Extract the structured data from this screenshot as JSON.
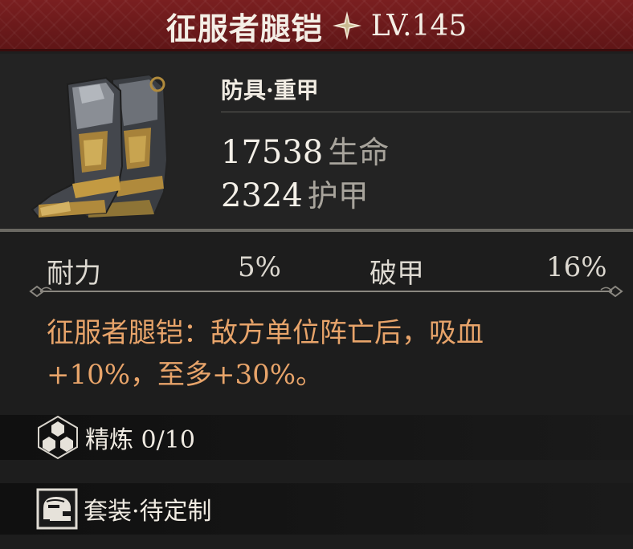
{
  "header": {
    "item_name": "征服者腿铠",
    "level": "LV.145",
    "star_icon": "four-point-star-icon"
  },
  "item": {
    "icon": "armored-boots-icon",
    "category": "防具·重甲",
    "stats": [
      {
        "value": "17538",
        "label": "生命"
      },
      {
        "value": "2324",
        "label": "护甲"
      }
    ]
  },
  "attributes": [
    {
      "name": "耐力",
      "value": "5%"
    },
    {
      "name": "破甲",
      "value": "16%"
    }
  ],
  "effect": {
    "line1": "征服者腿铠：敌方单位阵亡后，吸血",
    "line2": "+10%，至多+30%。"
  },
  "refine": {
    "icon": "hexagon-cluster-icon",
    "label": "精炼 0/10"
  },
  "set": {
    "icon": "helmet-icon",
    "label": "套装·待定制"
  },
  "colors": {
    "title_bg": "#6b1a1b",
    "effect_text": "#e8a46a",
    "panel_bg": "#232323"
  }
}
